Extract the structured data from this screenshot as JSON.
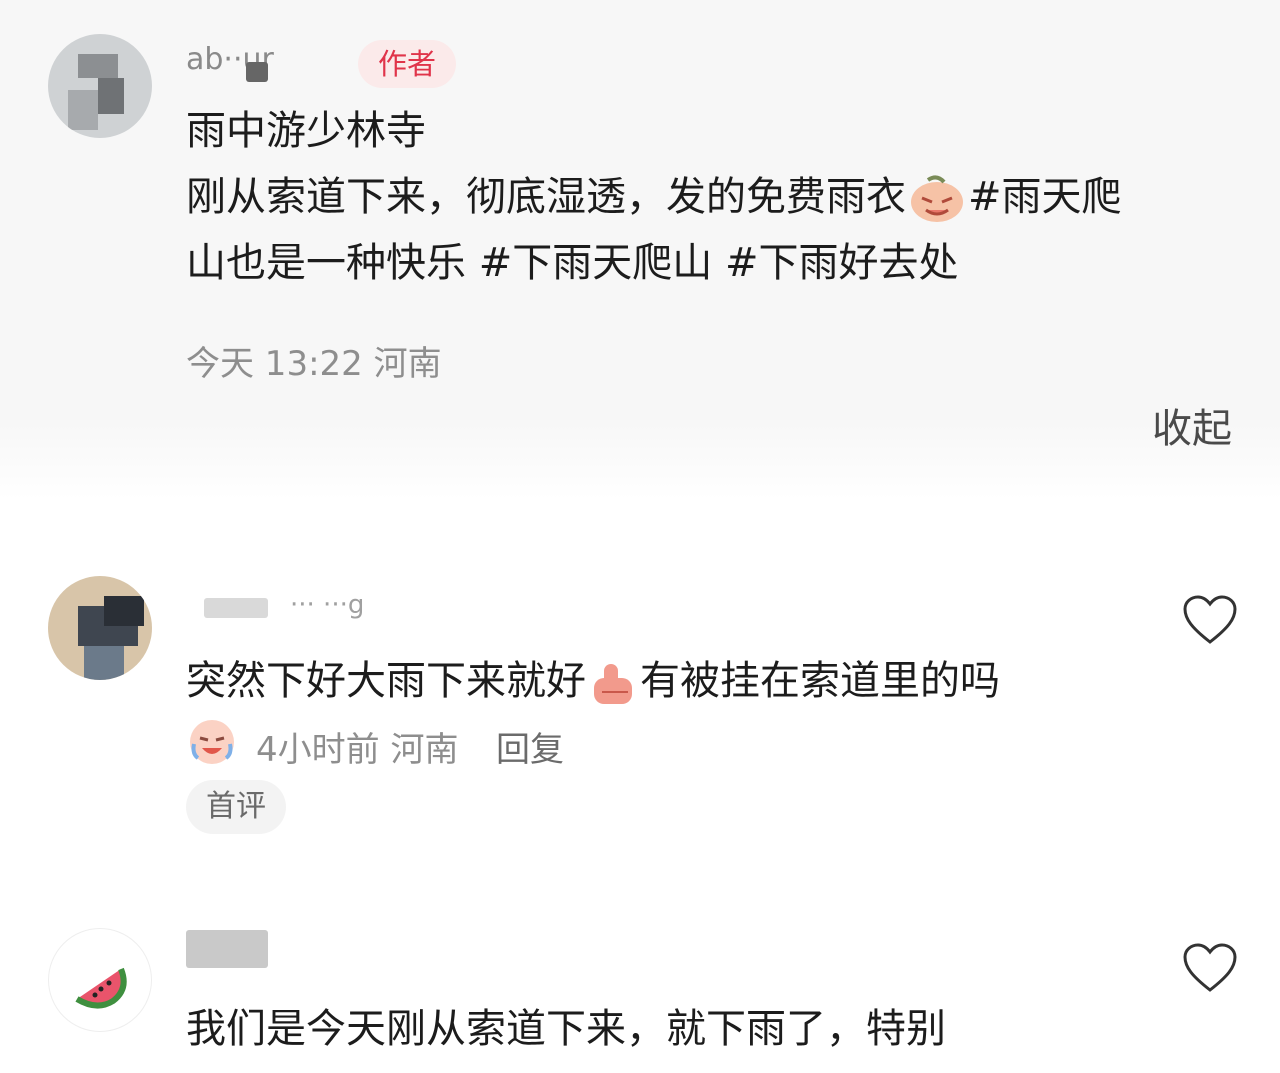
{
  "post": {
    "username": "ab··ur",
    "author_badge": "作者",
    "title": "雨中游少林寺",
    "body_line1_a": "刚从索道下来，彻底湿透，发的免费雨衣",
    "body_line1_b": "#雨天爬",
    "body_line2": "山也是一种快乐 #下雨天爬山 #下雨好去处",
    "meta": "今天 13:22 河南",
    "collapse_label": "收起"
  },
  "comments": [
    {
      "username": "··· ···g",
      "text_a": "突然下好大雨下来就好",
      "text_b": "有被挂在索道里的吗",
      "meta": "4小时前 河南",
      "reply_label": "回复",
      "tag": "首评",
      "icons": [
        "heart-icon",
        "crying-laugh-emoji",
        "thumbs-up-emoji"
      ]
    },
    {
      "username": "",
      "text": "我们是今天刚从索道下来，就下雨了，特别",
      "icons": [
        "heart-icon",
        "watermelon-avatar"
      ]
    }
  ],
  "colors": {
    "author_badge_text": "#e0344a",
    "author_badge_bg": "#fbeaea",
    "meta_text": "#8e8e8e"
  }
}
